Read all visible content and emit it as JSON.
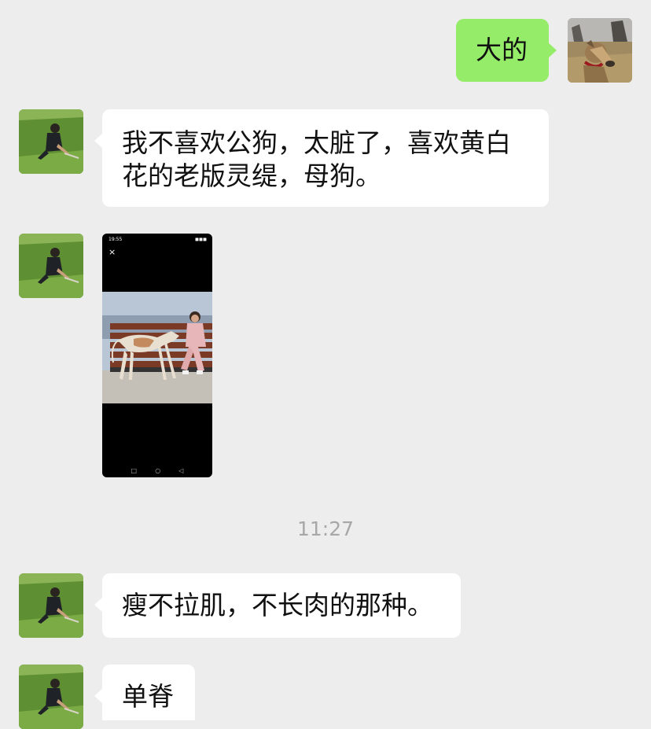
{
  "messages": [
    {
      "sender": "self",
      "text": "大的"
    },
    {
      "sender": "other",
      "text": "我不喜欢公狗，太脏了，喜欢黄白花的老版灵缇，母狗。"
    },
    {
      "sender": "other",
      "type": "image",
      "status_time": "19:55",
      "status_icons": "◼◼◼",
      "close_glyph": "×",
      "nav_back": "◁",
      "nav_home": "○",
      "nav_recent": "□"
    },
    {
      "sender": "other",
      "text": "瘦不拉肌，不长肉的那种。"
    },
    {
      "sender": "other",
      "text": "单脊"
    }
  ],
  "timestamp": "11:27",
  "colors": {
    "background": "#ededed",
    "self_bubble": "#95ec69",
    "other_bubble": "#ffffff",
    "timestamp_text": "#a7a7a7"
  },
  "icons": {
    "self_avatar": "greyhound-photo-avatar",
    "other_avatar": "man-in-grass-photo-avatar"
  }
}
